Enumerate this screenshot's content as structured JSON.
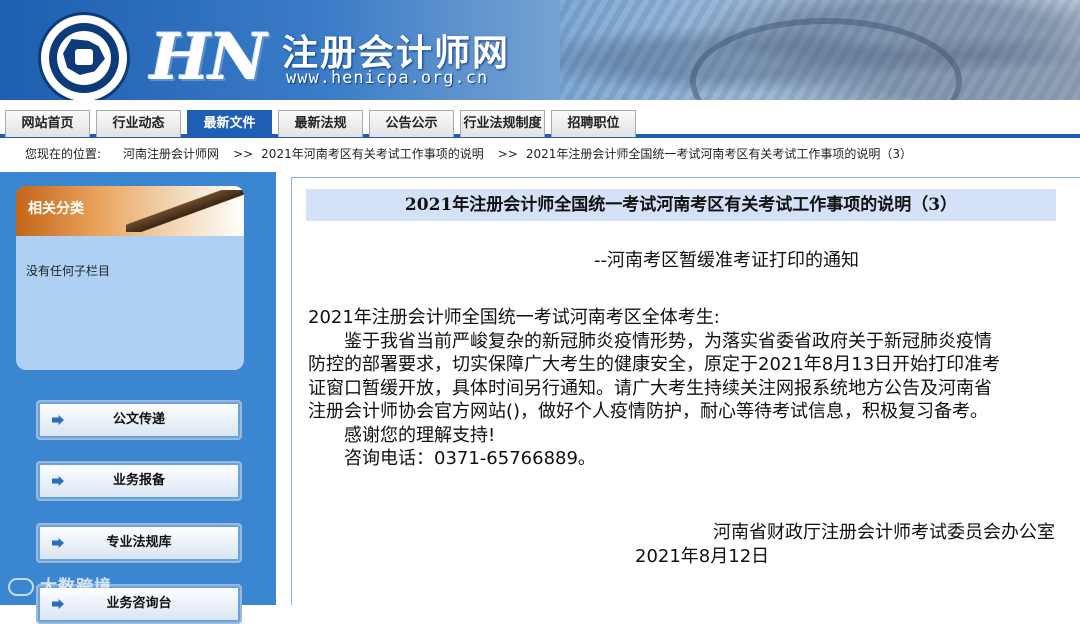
{
  "header": {
    "logo_initials": "HN",
    "site_title": "注册会计师网",
    "site_url": "www.henicpa.org.cn"
  },
  "nav": {
    "tabs": [
      {
        "label": "网站首页",
        "active": false
      },
      {
        "label": "行业动态",
        "active": false
      },
      {
        "label": "最新文件",
        "active": true
      },
      {
        "label": "最新法规",
        "active": false
      },
      {
        "label": "公告公示",
        "active": false
      },
      {
        "label": "行业法规制度",
        "active": false
      },
      {
        "label": "招聘职位",
        "active": false
      }
    ]
  },
  "breadcrumb": {
    "prefix": "您现在的位置:",
    "items": [
      "河南注册会计师网",
      "2021年河南考区有关考试工作事项的说明",
      "2021年注册会计师全国统一考试河南考区有关考试工作事项的说明（3）"
    ],
    "separator": ">>"
  },
  "sidebar": {
    "category_title": "相关分类",
    "empty_text": "没有任何子栏目",
    "buttons": [
      "公文传递",
      "业务报备",
      "专业法规库",
      "业务咨询台"
    ]
  },
  "article": {
    "title": "2021年注册会计师全国统一考试河南考区有关考试工作事项的说明（3）",
    "subtitle": "--河南考区暂缓准考证打印的通知",
    "salutation": "2021年注册会计师全国统一考试河南考区全体考生:",
    "paragraph_lines": [
      "鉴于我省当前严峻复杂的新冠肺炎疫情形势，为落实省委省政府关于新冠肺炎疫情",
      "防控的部署要求，切实保障广大考生的健康安全，原定于2021年8月13日开始打印准考",
      "证窗口暂缓开放，具体时间另行通知。请广大考生持续关注网报系统地方公告及河南省",
      "注册会计师协会官方网站()，做好个人疫情防护，耐心等待考试信息，积极复习备考。"
    ],
    "thanks": "感谢您的理解支持!",
    "phone": "咨询电话：0371-65766889。",
    "signature": "河南省财政厅注册会计师考试委员会办公室",
    "date": "2021年8月12日"
  },
  "watermark": "大数跨境",
  "colors": {
    "nav_active": "#1e5fb3",
    "sidebar_bg": "#3a86d0",
    "title_bar_bg": "#d5e1f7"
  }
}
